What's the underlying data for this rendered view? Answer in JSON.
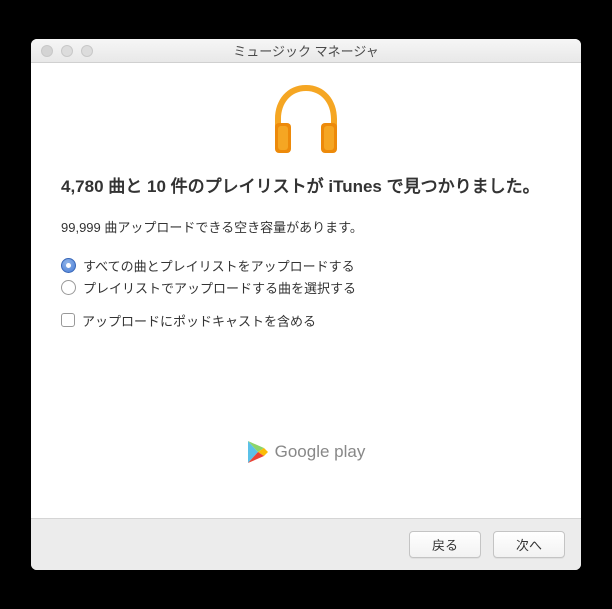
{
  "window": {
    "title": "ミュージック マネージャ"
  },
  "main": {
    "heading": "4,780 曲と 10 件のプレイリストが iTunes で見つかりました。",
    "subtext": "99,999 曲アップロードできる空き容量があります。"
  },
  "radios": {
    "option_all": "すべての曲とプレイリストをアップロードする",
    "option_select": "プレイリストでアップロードする曲を選択する"
  },
  "checkbox": {
    "include_podcasts": "アップロードにポッドキャストを含める"
  },
  "footer": {
    "brand": "Google play"
  },
  "buttons": {
    "back": "戻る",
    "next": "次へ"
  }
}
